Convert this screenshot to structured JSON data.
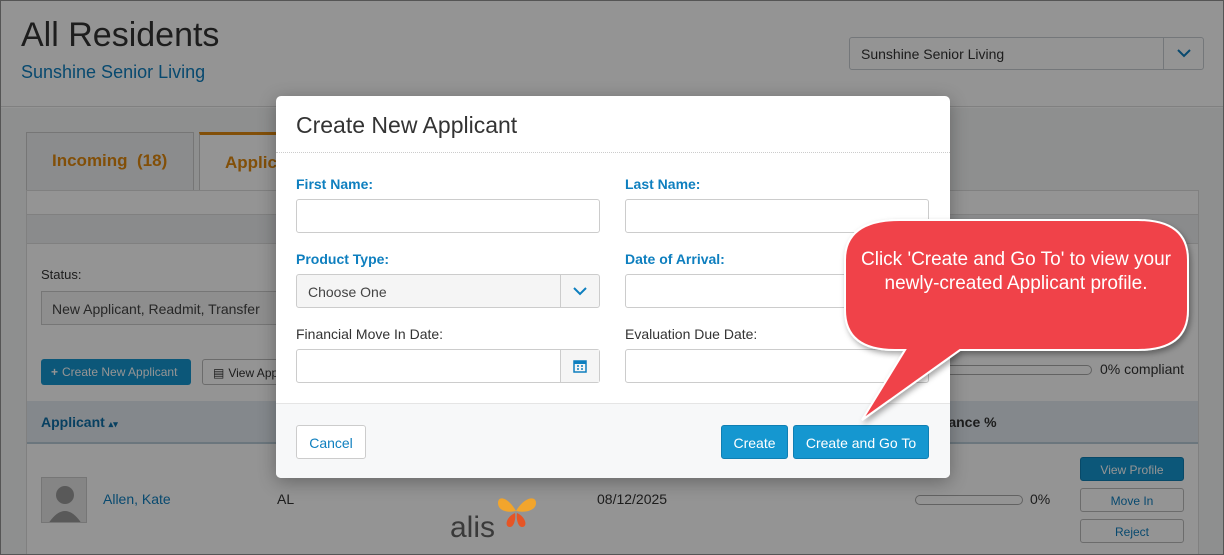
{
  "page": {
    "title": "All Residents",
    "subtitle": "Sunshine Senior Living",
    "community_select": "Sunshine Senior Living"
  },
  "tabs": [
    {
      "label": "Incoming  (18)"
    },
    {
      "label": "Applic"
    }
  ],
  "filters": {
    "status_label": "Status:",
    "status_value": "New Applicant, Readmit, Transfer"
  },
  "toolbar": {
    "create_new_applicant": "Create New Applicant",
    "view_app": "View App",
    "compliance_text": "0% compliant"
  },
  "table": {
    "headers": {
      "applicant": "Applicant",
      "compliance": "pliance %"
    },
    "rows": [
      {
        "name": "Allen, Kate",
        "type": "AL",
        "date": "08/12/2025",
        "compliance": "0%",
        "actions": [
          "View Profile",
          "Move In",
          "Reject"
        ]
      }
    ]
  },
  "logo_text": "alis",
  "modal": {
    "title": "Create New Applicant",
    "first_name_label": "First Name:",
    "last_name_label": "Last Name:",
    "product_type_label": "Product Type:",
    "product_type_value": "Choose One",
    "date_of_arrival_label": "Date of Arrival:",
    "financial_move_in_label": "Financial Move In Date:",
    "evaluation_due_label": "Evaluation Due Date:",
    "first_name_value": "",
    "last_name_value": "",
    "cancel_label": "Cancel",
    "create_label": "Create",
    "create_go_label": "Create and Go To"
  },
  "callout": {
    "text": "Click 'Create and Go To' to view your newly-created Applicant profile.",
    "color": "#f0434a"
  },
  "colors": {
    "accent_blue": "#1597d0",
    "link_blue": "#0e7fbf",
    "tab_orange": "#e0890e"
  }
}
